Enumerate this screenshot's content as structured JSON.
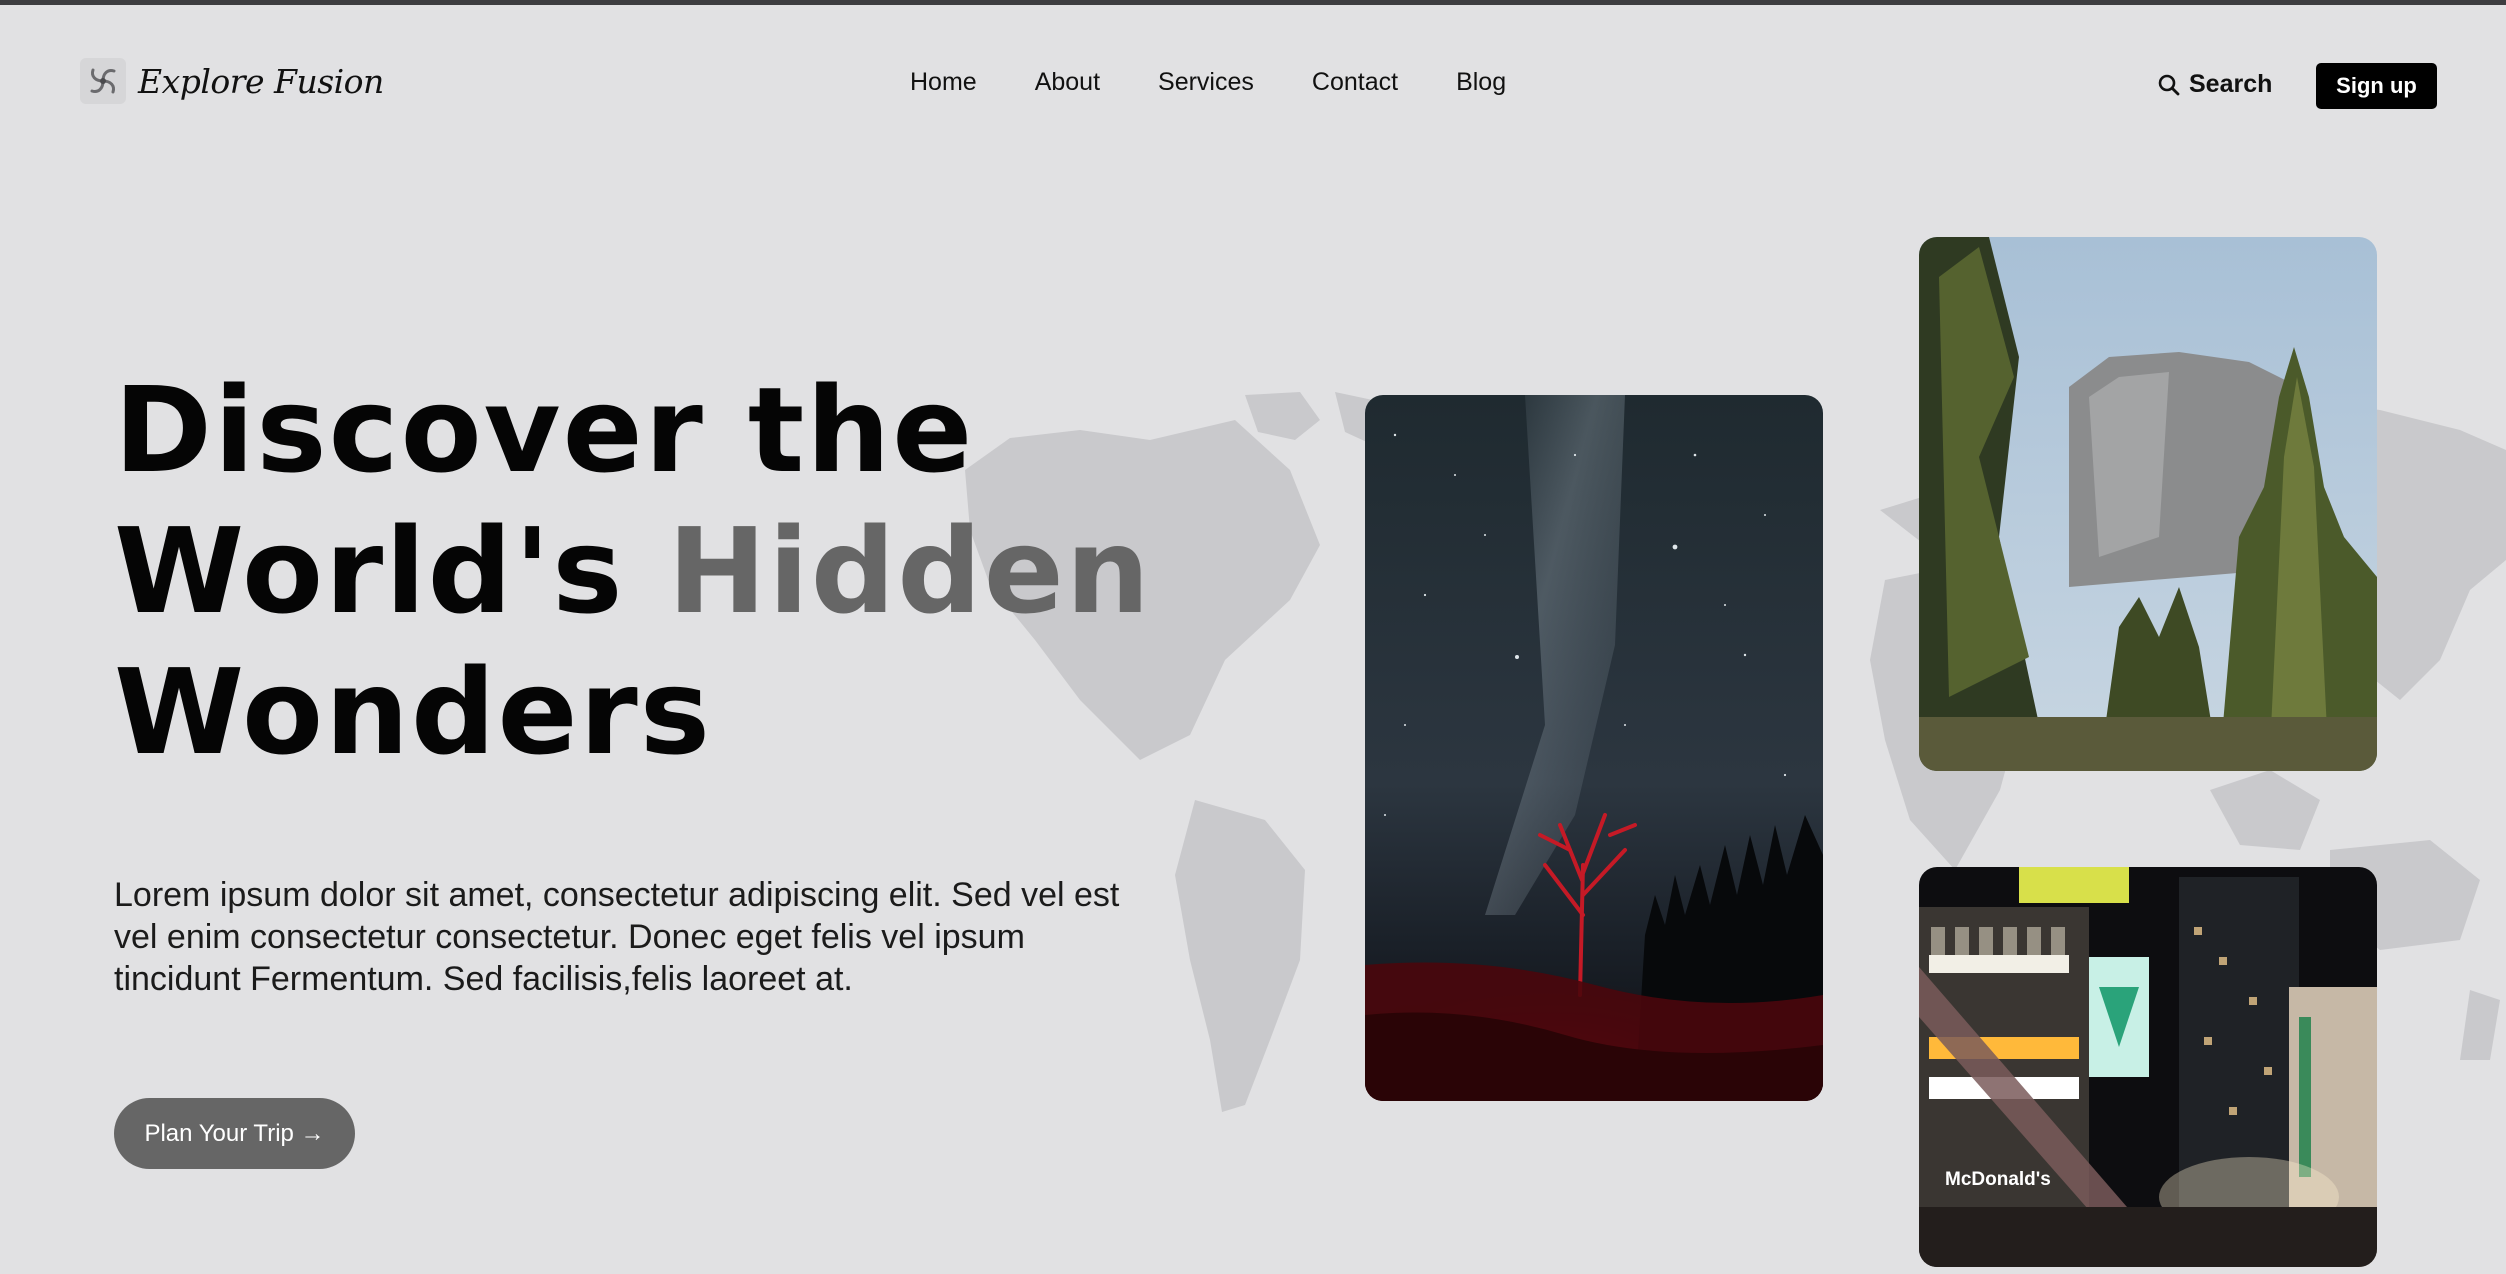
{
  "brand": {
    "name": "Explore Fusion",
    "logo_icon": "fan-swirl-icon"
  },
  "nav": {
    "items": [
      "Home",
      "About",
      "Services",
      "Contact",
      "Blog"
    ]
  },
  "header": {
    "search_label": "Search",
    "search_icon": "search-icon",
    "signup_label": "Sign up"
  },
  "hero": {
    "title_line1": "Discover the",
    "title_line2_a": "World's ",
    "title_line2_b": "Hidden",
    "title_line3": "Wonders",
    "description": "Lorem ipsum dolor sit amet, consectetur adipiscing elit. Sed vel est vel enim consectetur consectetur. Donec eget felis vel ipsum tincidunt Fermentum. Sed facilisis,felis laoreet at.",
    "cta_label": "Plan Your Trip",
    "cta_icon": "arrow-right-icon"
  },
  "gallery": {
    "city_sign_text": "McDonald's",
    "photos": [
      "night-sky-red-tree",
      "granite-cliff-pine-forest",
      "city-night-street"
    ]
  },
  "colors": {
    "background": "#e1e1e3",
    "accent_gray": "#666666",
    "button_black": "#000000",
    "map_gray": "#c9c9cc"
  }
}
